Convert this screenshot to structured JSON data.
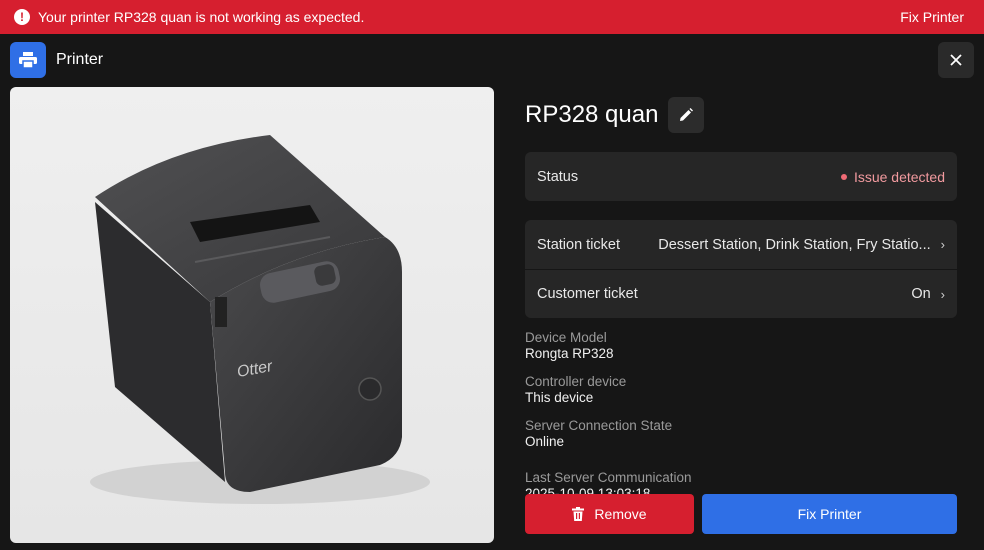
{
  "alert": {
    "message": "Your printer RP328 quan is not working as expected.",
    "action": "Fix Printer"
  },
  "header": {
    "title": "Printer"
  },
  "printer": {
    "name": "RP328 quan",
    "brand_mark": "Otter",
    "status": {
      "label": "Status",
      "value": "Issue detected"
    },
    "station_ticket": {
      "label": "Station ticket",
      "value": "Dessert Station, Drink Station, Fry Statio..."
    },
    "customer_ticket": {
      "label": "Customer ticket",
      "value": "On"
    },
    "info": [
      {
        "label": "Device Model",
        "value": "Rongta RP328"
      },
      {
        "label": "Controller device",
        "value": "This device"
      },
      {
        "label": "Server Connection State",
        "value": "Online"
      }
    ],
    "last_comm": {
      "label": "Last Server Communication",
      "value": "2025-10-09 13:03:18"
    }
  },
  "actions": {
    "remove": "Remove",
    "fix": "Fix Printer"
  },
  "colors": {
    "alert": "#d61f2f",
    "primary": "#2f6fe6",
    "danger": "#d61f2f",
    "background": "#161616"
  }
}
